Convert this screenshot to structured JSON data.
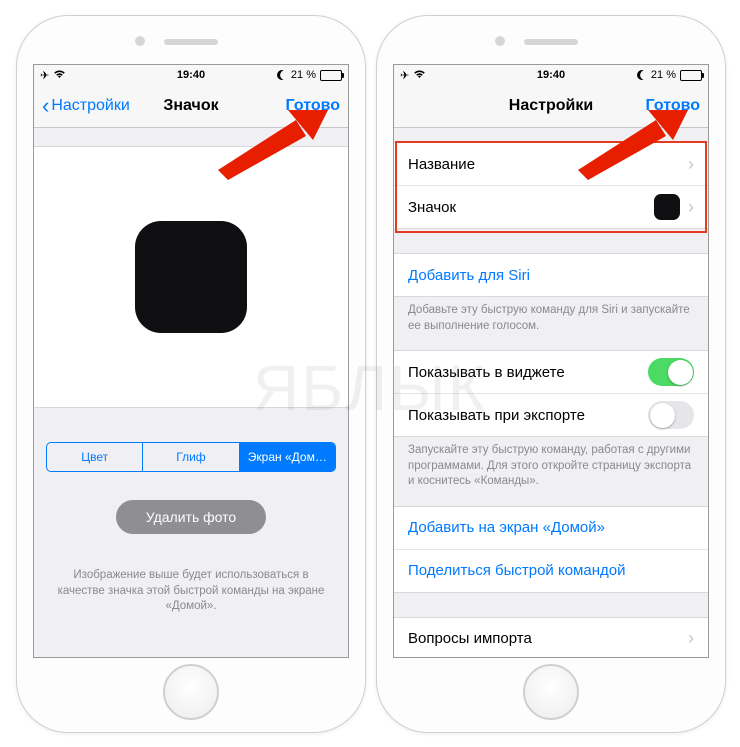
{
  "status": {
    "time": "19:40",
    "battery_pct": "21 %",
    "icons": {
      "airplane": "✈",
      "wifi": "📶",
      "dnd": "moon"
    }
  },
  "left": {
    "nav": {
      "back": "Настройки",
      "title": "Значок",
      "done": "Готово"
    },
    "segments": {
      "color": "Цвет",
      "glyph": "Глиф",
      "home": "Экран «Дом…"
    },
    "delete_photo": "Удалить фото",
    "footer": "Изображение выше будет использоваться в качестве значка этой быстрой команды на экране «Домой»."
  },
  "right": {
    "nav": {
      "title": "Настройки",
      "done": "Готово"
    },
    "rows": {
      "name": "Название",
      "icon": "Значок",
      "add_siri": "Добавить для Siri",
      "siri_footer": "Добавьте эту быструю команду для Siri и запускайте ее выполнение голосом.",
      "show_widget": "Показывать в виджете",
      "show_export": "Показывать при экспорте",
      "export_footer": "Запускайте эту быструю команду, работая с другими программами. Для этого откройте страницу экспорта и коснитесь «Команды».",
      "add_home": "Добавить на экран «Домой»",
      "share": "Поделиться быстрой командой",
      "import_q": "Вопросы импорта"
    },
    "toggles": {
      "widget_on": true,
      "export_on": false
    }
  },
  "watermark": "ЯБЛЫК"
}
